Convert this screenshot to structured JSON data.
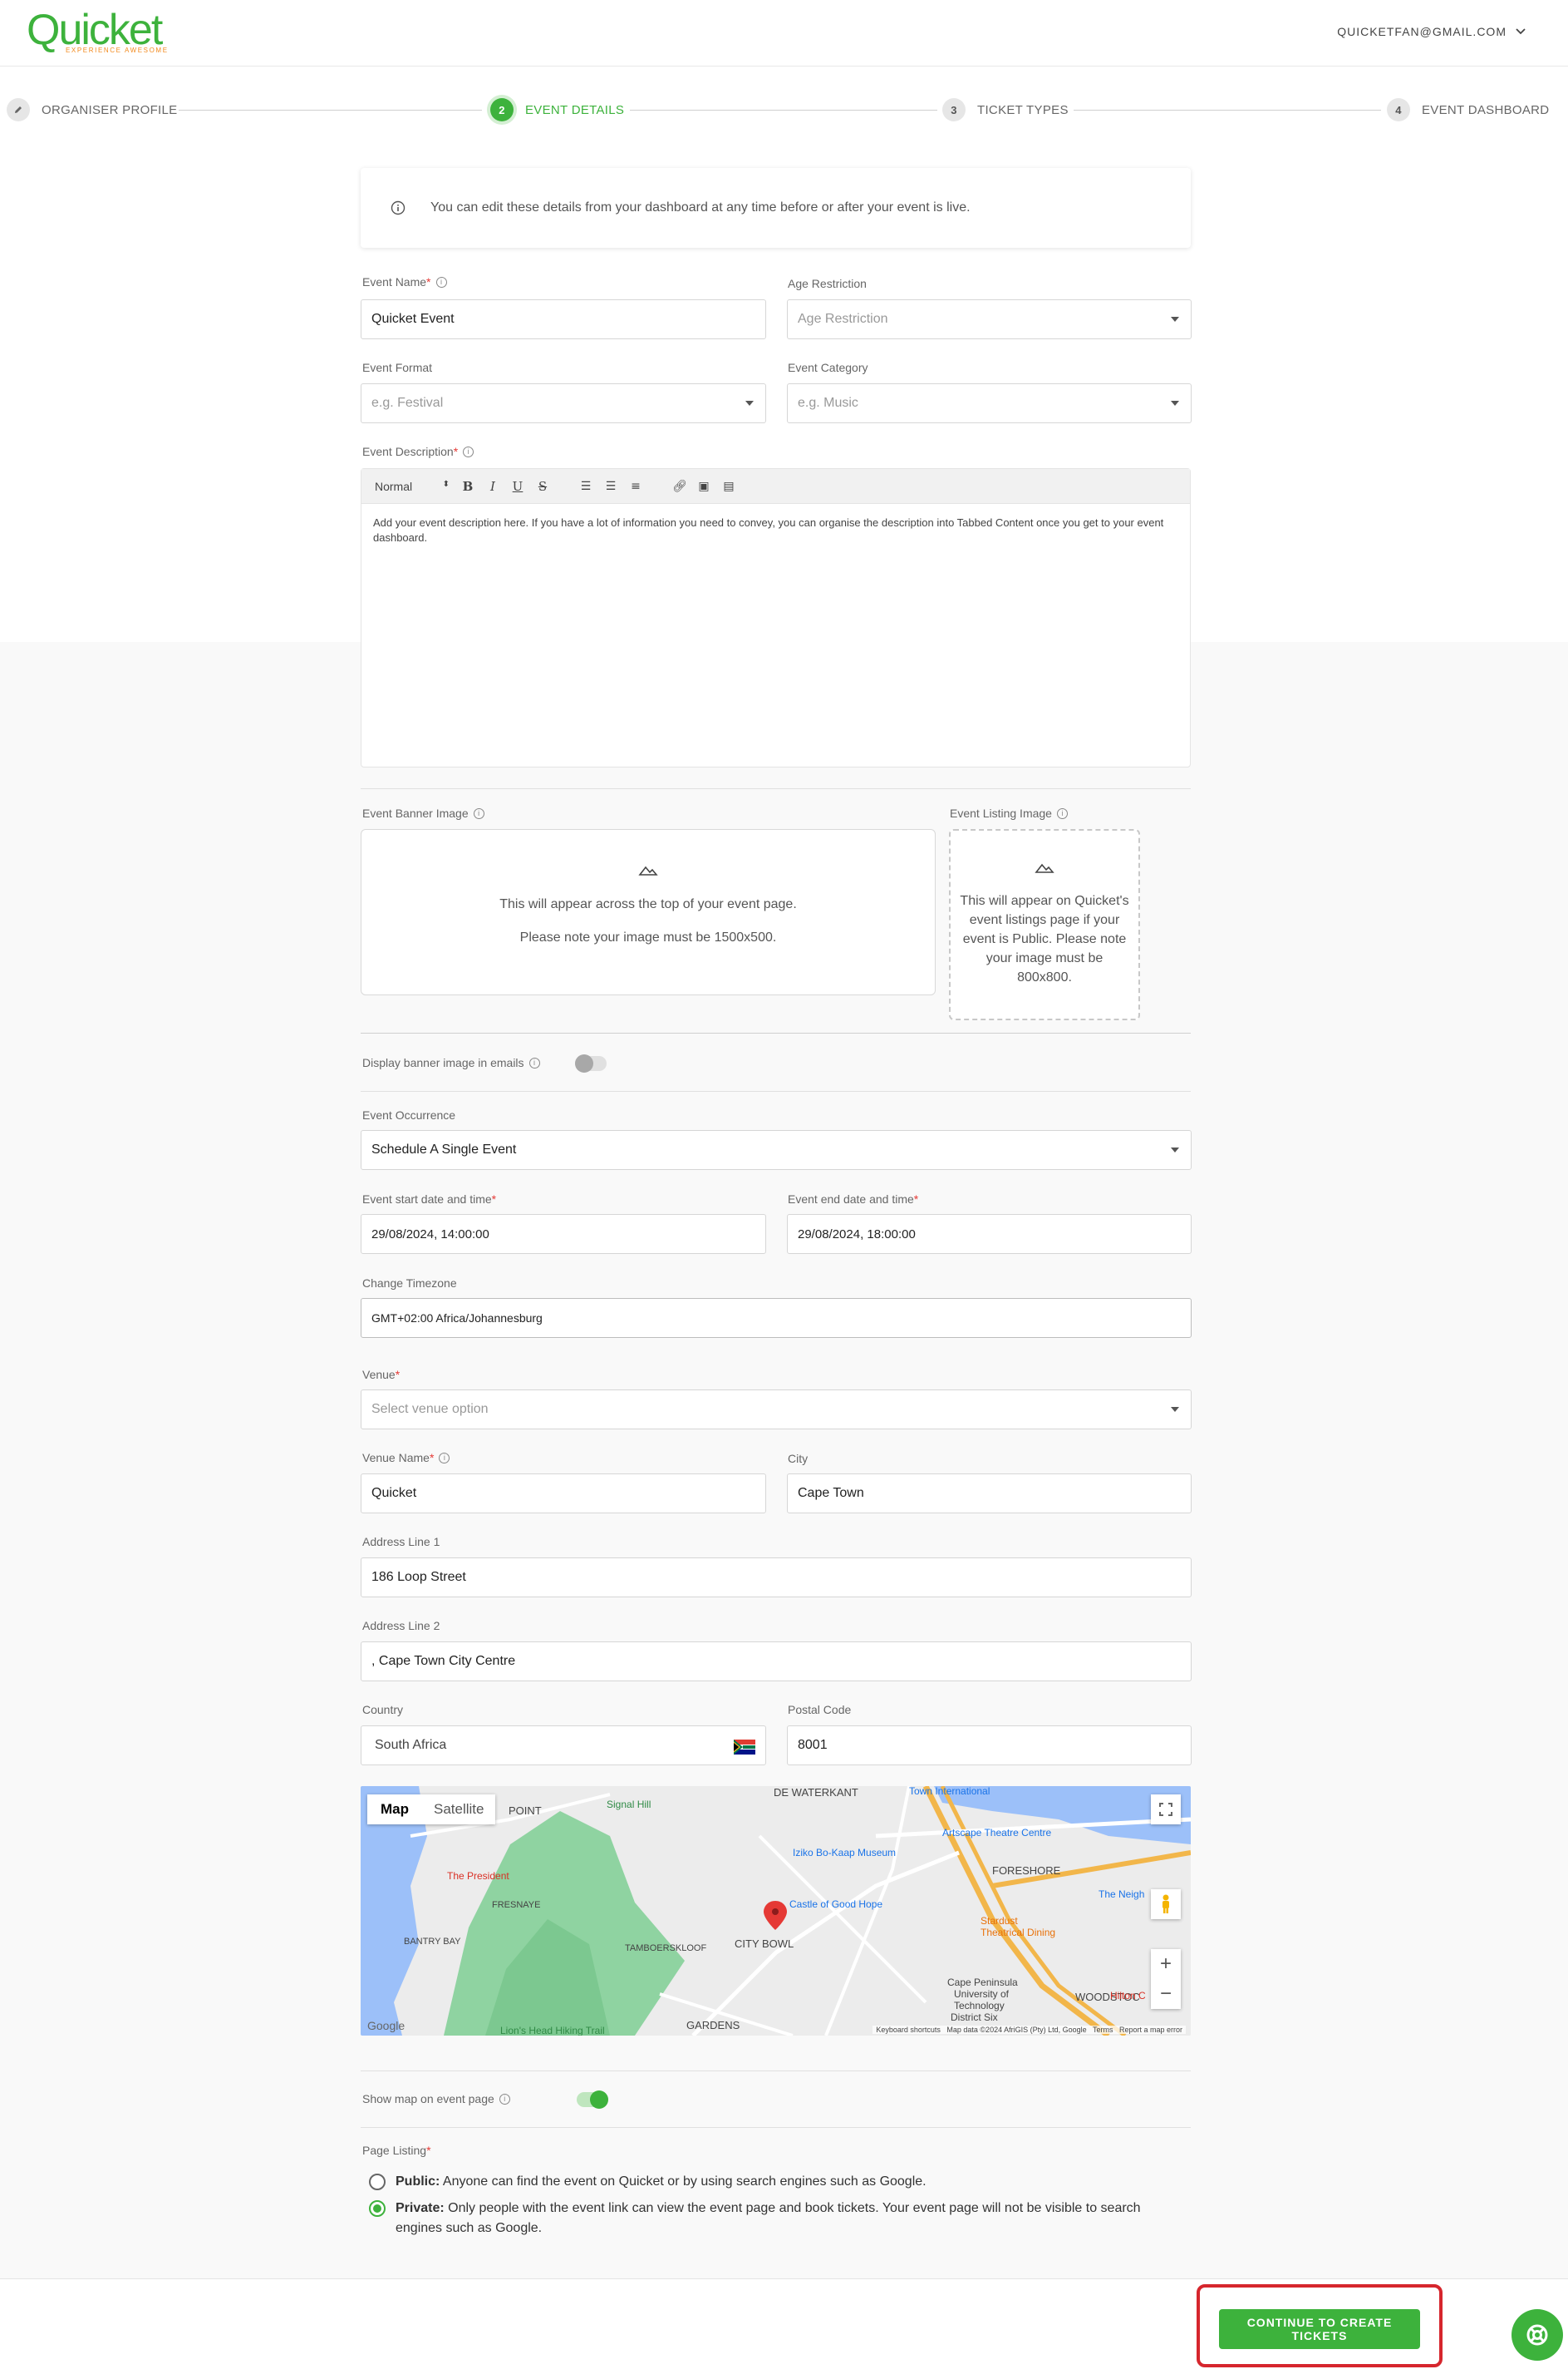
{
  "header": {
    "logo_text": "Quicket",
    "logo_tagline": "EXPERIENCE AWESOME",
    "account_email": "QUICKETFAN@GMAIL.COM"
  },
  "stepper": {
    "steps": [
      {
        "number": "",
        "label": "ORGANISER PROFILE",
        "state": "done"
      },
      {
        "number": "2",
        "label": "EVENT DETAILS",
        "state": "active"
      },
      {
        "number": "3",
        "label": "TICKET TYPES",
        "state": "pending"
      },
      {
        "number": "4",
        "label": "EVENT DASHBOARD",
        "state": "pending"
      }
    ]
  },
  "info_banner": "You can edit these details from your dashboard at any time before or after your event is live.",
  "form": {
    "event_name": {
      "label": "Event Name",
      "value": "Quicket Event"
    },
    "age_restriction": {
      "label": "Age Restriction",
      "placeholder": "Age Restriction"
    },
    "event_format": {
      "label": "Event Format",
      "placeholder": "e.g. Festival"
    },
    "event_category": {
      "label": "Event Category",
      "placeholder": "e.g. Music"
    },
    "event_description": {
      "label": "Event Description",
      "toolbar_style": "Normal",
      "text": "Add your event description here. If you have a lot of information you need to convey, you can organise the description into Tabbed Content once you get to your event dashboard."
    },
    "banner_image": {
      "label": "Event Banner Image",
      "line1": "This will appear across the top of your event page.",
      "line2": "Please note your image must be 1500x500."
    },
    "listing_image": {
      "label": "Event Listing Image",
      "text": "This will appear on Quicket's event listings page if your event is Public. Please note your image must be 800x800."
    },
    "display_banner": {
      "label": "Display banner image in emails",
      "enabled": false
    },
    "occurrence": {
      "label": "Event Occurrence",
      "value": "Schedule A Single Event"
    },
    "start": {
      "label": "Event start date and time",
      "value": "29/08/2024, 14:00:00"
    },
    "end": {
      "label": "Event end date and time",
      "value": "29/08/2024, 18:00:00"
    },
    "timezone": {
      "label": "Change Timezone",
      "value": "GMT+02:00 Africa/Johannesburg"
    },
    "venue": {
      "label": "Venue",
      "placeholder": "Select venue option"
    },
    "venue_name": {
      "label": "Venue Name",
      "value": "Quicket"
    },
    "city": {
      "label": "City",
      "value": "Cape Town"
    },
    "address1": {
      "label": "Address Line 1",
      "value": "186 Loop Street"
    },
    "address2": {
      "label": "Address Line 2",
      "value": ", Cape Town City Centre"
    },
    "country": {
      "label": "Country",
      "value": "South Africa"
    },
    "postal_code": {
      "label": "Postal Code",
      "value": "8001"
    },
    "show_map": {
      "label": "Show map on event page",
      "enabled": true
    },
    "page_listing": {
      "label": "Page Listing",
      "options": [
        {
          "title": "Public:",
          "text": "Anyone can find the event on Quicket or by using search engines such as Google.",
          "selected": false
        },
        {
          "title": "Private:",
          "text": "Only people with the event link can view the event page and book tickets. Your event page will not be visible to search engines such as Google.",
          "selected": true
        }
      ]
    }
  },
  "map": {
    "tab_map": "Map",
    "tab_satellite": "Satellite",
    "labels": [
      "POINT",
      "Signal Hill",
      "DE WATERKANT",
      "Town International",
      "Iziko Bo-Kaap Museum",
      "Artscape Theatre Centre",
      "FORESHORE",
      "The President",
      "FRESNAYE",
      "Castle of Good Hope",
      "The Neigh",
      "CITY BOWL",
      "Stardust Theatrical Dining",
      "BANTRY BAY",
      "TAMBOERSKLOOF",
      "WOODSTOC",
      "Cape Peninsula University of Technology District Six",
      "Hilton C",
      "GARDENS",
      "Lion's Head Hiking Trail"
    ],
    "attribution": "Keyboard shortcuts   Map data ©2024 AfriGIS (Pty) Ltd, Google   Terms   Report a map error",
    "google": "Google",
    "zoom_in": "+",
    "zoom_out": "−"
  },
  "footer": {
    "continue_label": "CONTINUE TO CREATE TICKETS"
  },
  "colors": {
    "brand_green": "#3db23c",
    "highlight_red": "#d6262d",
    "tagline_orange": "#f28a1e"
  }
}
